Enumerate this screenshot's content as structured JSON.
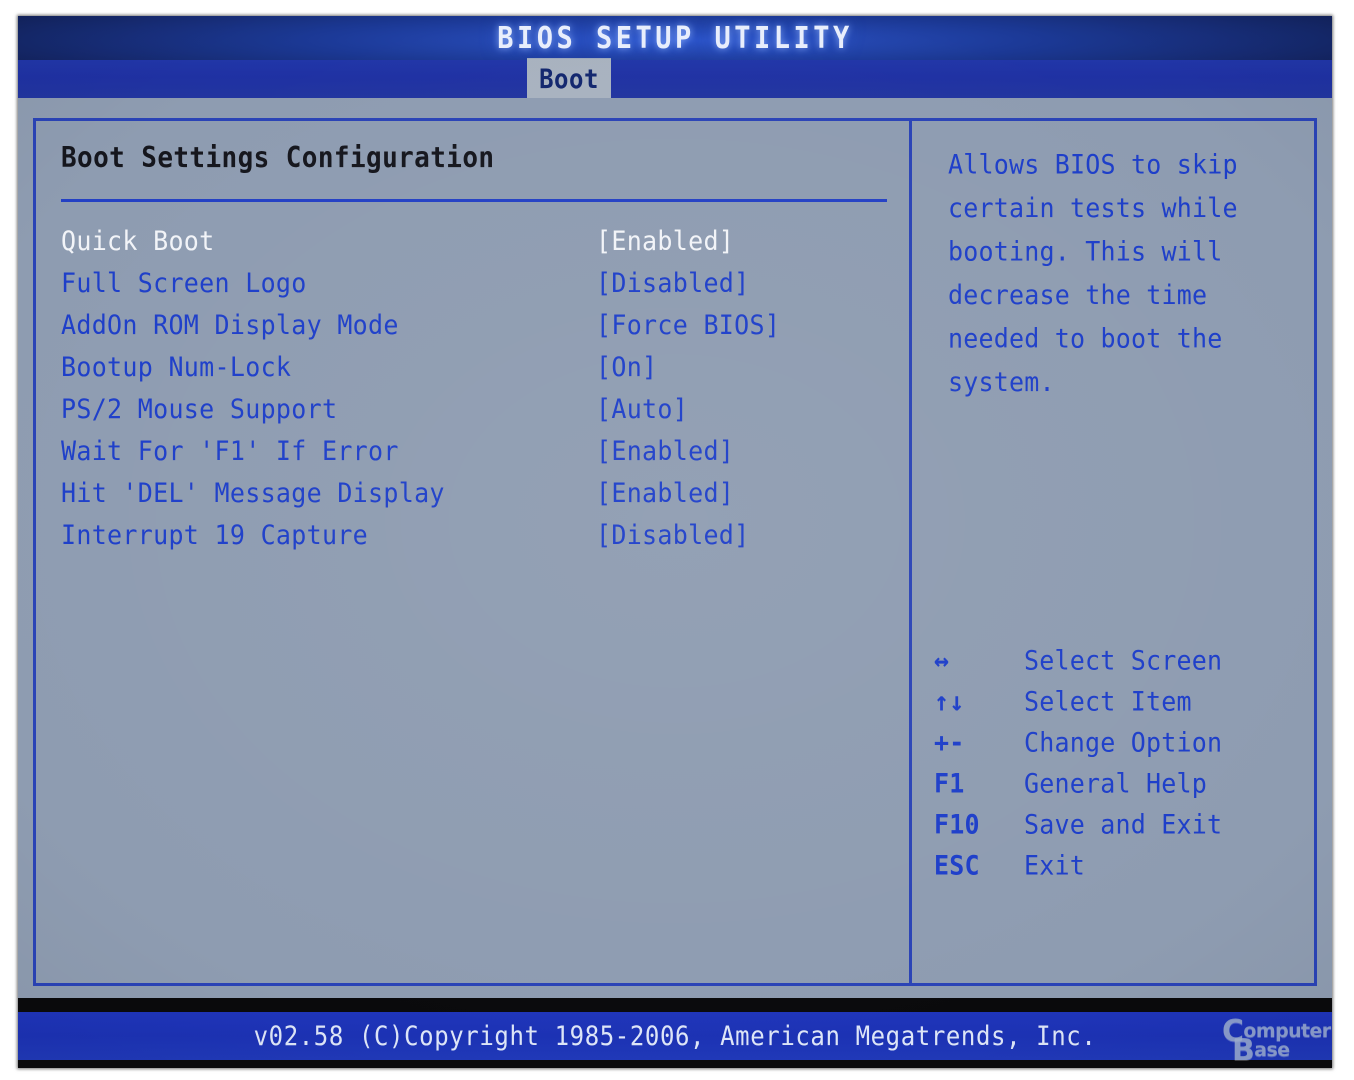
{
  "window": {
    "title": "BIOS SETUP UTILITY"
  },
  "menu": {
    "active_tab": "Boot"
  },
  "main": {
    "section_title": "Boot Settings Configuration",
    "settings": [
      {
        "label": "Quick Boot",
        "value": "[Enabled]",
        "selected": true
      },
      {
        "label": "Full Screen Logo",
        "value": "[Disabled]",
        "selected": false
      },
      {
        "label": "AddOn ROM Display Mode",
        "value": "[Force BIOS]",
        "selected": false
      },
      {
        "label": "Bootup Num-Lock",
        "value": "[On]",
        "selected": false
      },
      {
        "label": "PS/2 Mouse Support",
        "value": "[Auto]",
        "selected": false
      },
      {
        "label": "Wait For 'F1' If Error",
        "value": "[Enabled]",
        "selected": false
      },
      {
        "label": "Hit 'DEL' Message Display",
        "value": "[Enabled]",
        "selected": false
      },
      {
        "label": "Interrupt 19 Capture",
        "value": "[Disabled]",
        "selected": false
      }
    ]
  },
  "help": {
    "text": "Allows BIOS to skip\ncertain tests while\nbooting. This will\ndecrease the time\nneeded to boot the\nsystem."
  },
  "legend": {
    "items": [
      {
        "key": "↔",
        "icon": "left-right-arrow-icon",
        "desc": "Select Screen"
      },
      {
        "key": "↑↓",
        "icon": "up-down-arrow-icon",
        "desc": "Select Item"
      },
      {
        "key": "+-",
        "icon": "plus-minus-icon",
        "desc": "Change Option"
      },
      {
        "key": "F1",
        "icon": "f1-key-icon",
        "desc": "General Help"
      },
      {
        "key": "F10",
        "icon": "f10-key-icon",
        "desc": "Save and Exit"
      },
      {
        "key": "ESC",
        "icon": "esc-key-icon",
        "desc": "Exit"
      }
    ]
  },
  "footer": {
    "copyright": "v02.58 (C)Copyright 1985-2006, American Megatrends, Inc."
  },
  "watermark": {
    "line1_cap": "C",
    "line1_rest": "omputer",
    "line2_cap": "B",
    "line2_rest": "ase"
  },
  "colors": {
    "screen_bg": "#8e9cb1",
    "text_blue": "#1d3ec9",
    "border_blue": "#2a43b6",
    "bar_blue": "#1f35ba",
    "selected_text": "#f2f4f8",
    "section_title": "#15161d",
    "tab_bg": "#a8b2bf",
    "tab_text": "#12266e"
  }
}
